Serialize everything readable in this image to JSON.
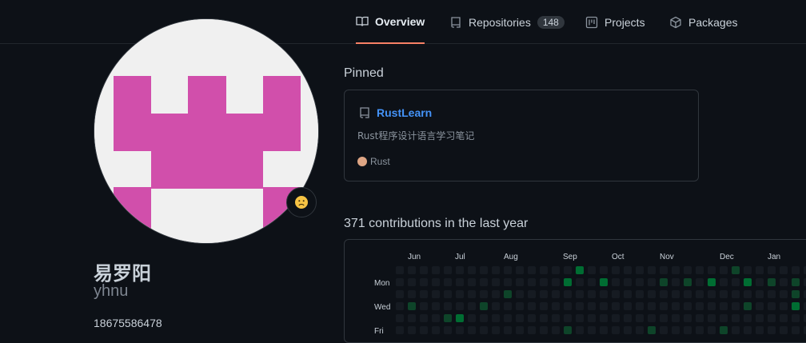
{
  "nav": {
    "tabs": [
      {
        "label": "Overview",
        "icon": "book-icon",
        "active": true
      },
      {
        "label": "Repositories",
        "icon": "repo-icon",
        "count": "148"
      },
      {
        "label": "Projects",
        "icon": "project-icon"
      },
      {
        "label": "Packages",
        "icon": "package-icon"
      }
    ]
  },
  "profile": {
    "full_name": "易罗阳",
    "login": "yhnu",
    "phone": "18675586478",
    "avatar_colors": {
      "fg": "#d14fab",
      "bg": "#f0f0f0"
    },
    "status_emoji": "face-icon"
  },
  "pinned": {
    "title": "Pinned",
    "card": {
      "name": "RustLearn",
      "description": "Rust程序设计语言学习笔记",
      "language": "Rust",
      "language_color": "#dea584"
    }
  },
  "contributions": {
    "title": "371 contributions in the last year",
    "months": [
      "Jun",
      "Jul",
      "Aug",
      "Sep",
      "Oct",
      "Nov",
      "Dec",
      "Jan"
    ],
    "days": [
      "Mon",
      "Wed",
      "Fri"
    ],
    "colors": {
      "empty": "#161b22",
      "l1": "#0e4429",
      "l2": "#006d32"
    }
  }
}
